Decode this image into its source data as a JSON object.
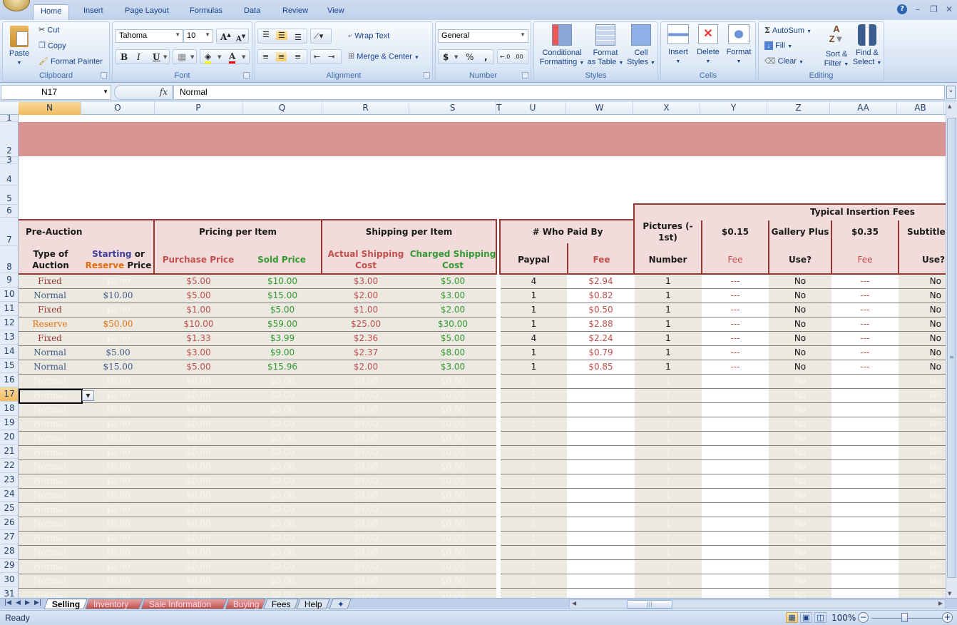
{
  "app": {
    "title": "Microsoft Excel"
  },
  "ribbon_tabs": [
    "Home",
    "Insert",
    "Page Layout",
    "Formulas",
    "Data",
    "Review",
    "View"
  ],
  "active_tab": "Home",
  "clipboard": {
    "paste": "Paste",
    "cut": "Cut",
    "copy": "Copy",
    "format_painter": "Format Painter",
    "label": "Clipboard"
  },
  "font": {
    "name": "Tahoma",
    "size": "10",
    "label": "Font",
    "bold": "B",
    "italic": "I",
    "underline": "U"
  },
  "alignment": {
    "wrap_text": "Wrap Text",
    "merge_center": "Merge & Center",
    "label": "Alignment"
  },
  "number": {
    "format": "General",
    "currency": "$",
    "percent": "%",
    "comma": ",",
    "inc_decimal": ".00→.0",
    "dec_decimal": ".0→.00",
    "label": "Number"
  },
  "styles": {
    "conditional": "Conditional",
    "conditional2": "Formatting",
    "format_table": "Format",
    "format_table2": "as Table",
    "cell_styles": "Cell",
    "cell_styles2": "Styles",
    "label": "Styles"
  },
  "cells": {
    "insert": "Insert",
    "delete": "Delete",
    "format": "Format",
    "label": "Cells"
  },
  "editing": {
    "autosum": "AutoSum",
    "fill": "Fill",
    "clear": "Clear",
    "sort": "Sort &",
    "sort2": "Filter",
    "find": "Find &",
    "find2": "Select",
    "label": "Editing"
  },
  "formula_bar": {
    "name_box": "N17",
    "fx": "fx",
    "formula": "Normal"
  },
  "columns": [
    "N",
    "O",
    "P",
    "Q",
    "R",
    "S",
    "T",
    "U",
    "W",
    "X",
    "Y",
    "Z",
    "AA",
    "AB"
  ],
  "selected_column": "N",
  "rows": [
    "1",
    "2",
    "3",
    "4",
    "5",
    "6",
    "7",
    "8",
    "9",
    "10",
    "11",
    "12",
    "13",
    "14",
    "15",
    "16",
    "17",
    "18",
    "19",
    "20",
    "21",
    "22",
    "23",
    "24",
    "25",
    "26",
    "27",
    "28",
    "29",
    "30",
    "31"
  ],
  "selected_row": "17",
  "headers": {
    "pre_auction": "Pre-Auction",
    "type_of": "Type of",
    "auction": "Auction",
    "starting": "Starting",
    "or": " or",
    "reserve": "Reserve",
    "price": " Price",
    "pricing_per_item": "Pricing per Item",
    "purchase_price": "Purchase Price",
    "sold_price": "Sold Price",
    "shipping_per_item": "Shipping per Item",
    "actual_shipping": "Actual Shipping",
    "actual_cost": "Cost",
    "charged_shipping": "Charged Shipping",
    "charged_cost": "Cost",
    "who_paid_by": "# Who Paid By",
    "paypal": "Paypal",
    "fee": "Fee",
    "typical_insertion_fees": "Typical Insertion Fees",
    "pictures1": "Pictures (-",
    "pictures2": "1st)",
    "number": "Number",
    "price_015": "$0.15",
    "fee2": "Fee",
    "gallery_plus": "Gallery Plus",
    "use": "Use?",
    "price_035": "$0.35",
    "fee3": "Fee",
    "subtitle": "Subtitle",
    "use2": "Use?"
  },
  "data_rows": [
    {
      "row": "9",
      "type": "Fixed",
      "start": "$0.00",
      "purchase": "$5.00",
      "sold": "$10.00",
      "actual": "$3.00",
      "charged": "$5.00",
      "paypal": "4",
      "fee": "$2.94",
      "pictures": "1",
      "pic_fee": "---",
      "gallery": "No",
      "gal_fee": "---",
      "subtitle": "No"
    },
    {
      "row": "10",
      "type": "Normal",
      "start": "$10.00",
      "purchase": "$5.00",
      "sold": "$15.00",
      "actual": "$2.00",
      "charged": "$3.00",
      "paypal": "1",
      "fee": "$0.82",
      "pictures": "1",
      "pic_fee": "---",
      "gallery": "No",
      "gal_fee": "---",
      "subtitle": "No"
    },
    {
      "row": "11",
      "type": "Fixed",
      "start": "$0.00",
      "purchase": "$1.00",
      "sold": "$5.00",
      "actual": "$1.00",
      "charged": "$2.00",
      "paypal": "1",
      "fee": "$0.50",
      "pictures": "1",
      "pic_fee": "---",
      "gallery": "No",
      "gal_fee": "---",
      "subtitle": "No"
    },
    {
      "row": "12",
      "type": "Reserve",
      "start": "$50.00",
      "purchase": "$10.00",
      "sold": "$59.00",
      "actual": "$25.00",
      "charged": "$30.00",
      "paypal": "1",
      "fee": "$2.88",
      "pictures": "1",
      "pic_fee": "---",
      "gallery": "No",
      "gal_fee": "---",
      "subtitle": "No"
    },
    {
      "row": "13",
      "type": "Fixed",
      "start": "$0.00",
      "purchase": "$1.33",
      "sold": "$3.99",
      "actual": "$2.36",
      "charged": "$5.00",
      "paypal": "4",
      "fee": "$2.24",
      "pictures": "1",
      "pic_fee": "---",
      "gallery": "No",
      "gal_fee": "---",
      "subtitle": "No"
    },
    {
      "row": "14",
      "type": "Normal",
      "start": "$5.00",
      "purchase": "$3.00",
      "sold": "$9.00",
      "actual": "$2.37",
      "charged": "$8.00",
      "paypal": "1",
      "fee": "$0.79",
      "pictures": "1",
      "pic_fee": "---",
      "gallery": "No",
      "gal_fee": "---",
      "subtitle": "No"
    },
    {
      "row": "15",
      "type": "Normal",
      "start": "$15.00",
      "purchase": "$5.00",
      "sold": "$15.96",
      "actual": "$2.00",
      "charged": "$3.00",
      "paypal": "1",
      "fee": "$0.85",
      "pictures": "1",
      "pic_fee": "---",
      "gallery": "No",
      "gal_fee": "---",
      "subtitle": "No"
    }
  ],
  "empty_row": {
    "type": "Normal",
    "money": "$0.00",
    "count": "1",
    "no": "No"
  },
  "sheet_tabs": [
    {
      "label": "Selling",
      "active": true,
      "color": "#ffffff"
    },
    {
      "label": "Inventory",
      "active": false,
      "color": "#c0504d"
    },
    {
      "label": "Sale Information",
      "active": false,
      "color": "#c0504d"
    },
    {
      "label": "Buying",
      "active": false,
      "color": "#c0504d"
    },
    {
      "label": "Fees",
      "active": false,
      "color": "#dbe5f1"
    },
    {
      "label": "Help",
      "active": false,
      "color": "#dbe5f1"
    }
  ],
  "status": {
    "text": "Ready",
    "zoom": "100%"
  },
  "colors": {
    "header_fill": "#f2dcdb",
    "header_border": "#953735",
    "band": "#d99594",
    "purchase": "#c0504d",
    "sold": "#339933",
    "normal": "#3f5a8a",
    "fixed": "#953735",
    "reserve": "#e46c0a",
    "starting": "#403f9d",
    "fee": "#c0504d"
  }
}
